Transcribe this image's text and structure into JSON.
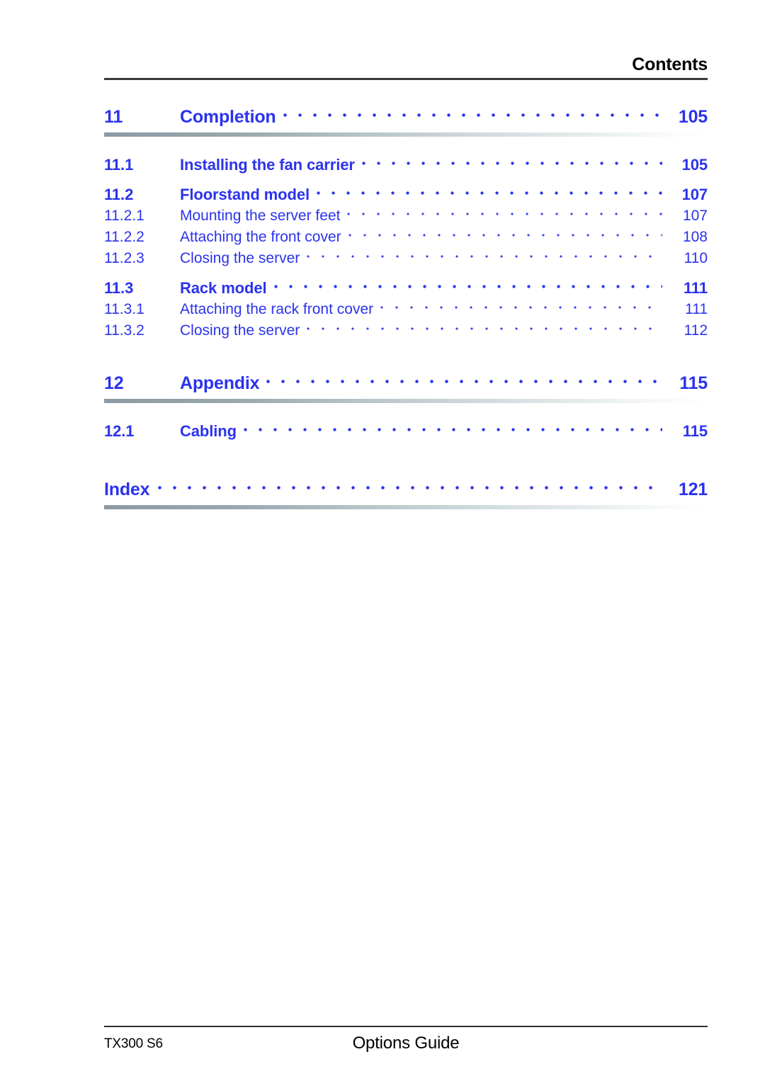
{
  "header": {
    "title": "Contents"
  },
  "toc": {
    "entries": [
      {
        "level": "chapter",
        "number": "11",
        "title": "Completion",
        "page": "105",
        "rule_after": true
      },
      {
        "level": "section",
        "number": "11.1",
        "title": "Installing the fan carrier",
        "page": "105",
        "rule_after": false
      },
      {
        "level": "section",
        "number": "11.2",
        "title": "Floorstand model",
        "page": "107",
        "rule_after": false
      },
      {
        "level": "subsection",
        "number": "11.2.1",
        "title": "Mounting the server feet",
        "page": "107",
        "rule_after": false
      },
      {
        "level": "subsection",
        "number": "11.2.2",
        "title": "Attaching the front cover",
        "page": "108",
        "rule_after": false
      },
      {
        "level": "subsection",
        "number": "11.2.3",
        "title": "Closing the server",
        "page": "110",
        "rule_after": false
      },
      {
        "level": "section",
        "number": "11.3",
        "title": "Rack model",
        "page": "111",
        "rule_after": false
      },
      {
        "level": "subsection",
        "number": "11.3.1",
        "title": "Attaching the rack front cover",
        "page": "111",
        "rule_after": false
      },
      {
        "level": "subsection",
        "number": "11.3.2",
        "title": "Closing the server",
        "page": "112",
        "rule_after": false
      },
      {
        "level": "chapter",
        "number": "12",
        "title": "Appendix",
        "page": "115",
        "rule_after": true
      },
      {
        "level": "section",
        "number": "12.1",
        "title": "Cabling",
        "page": "115",
        "rule_after": false
      },
      {
        "level": "index",
        "number": "",
        "title": "Index",
        "page": "121",
        "rule_after": true
      }
    ]
  },
  "footer": {
    "left": "TX300 S6",
    "center": "Options Guide"
  },
  "colors": {
    "link_blue": "#2b33ec",
    "rule_dark": "#3a3a3a",
    "rule_gradient_start": "#8d9aa3"
  }
}
